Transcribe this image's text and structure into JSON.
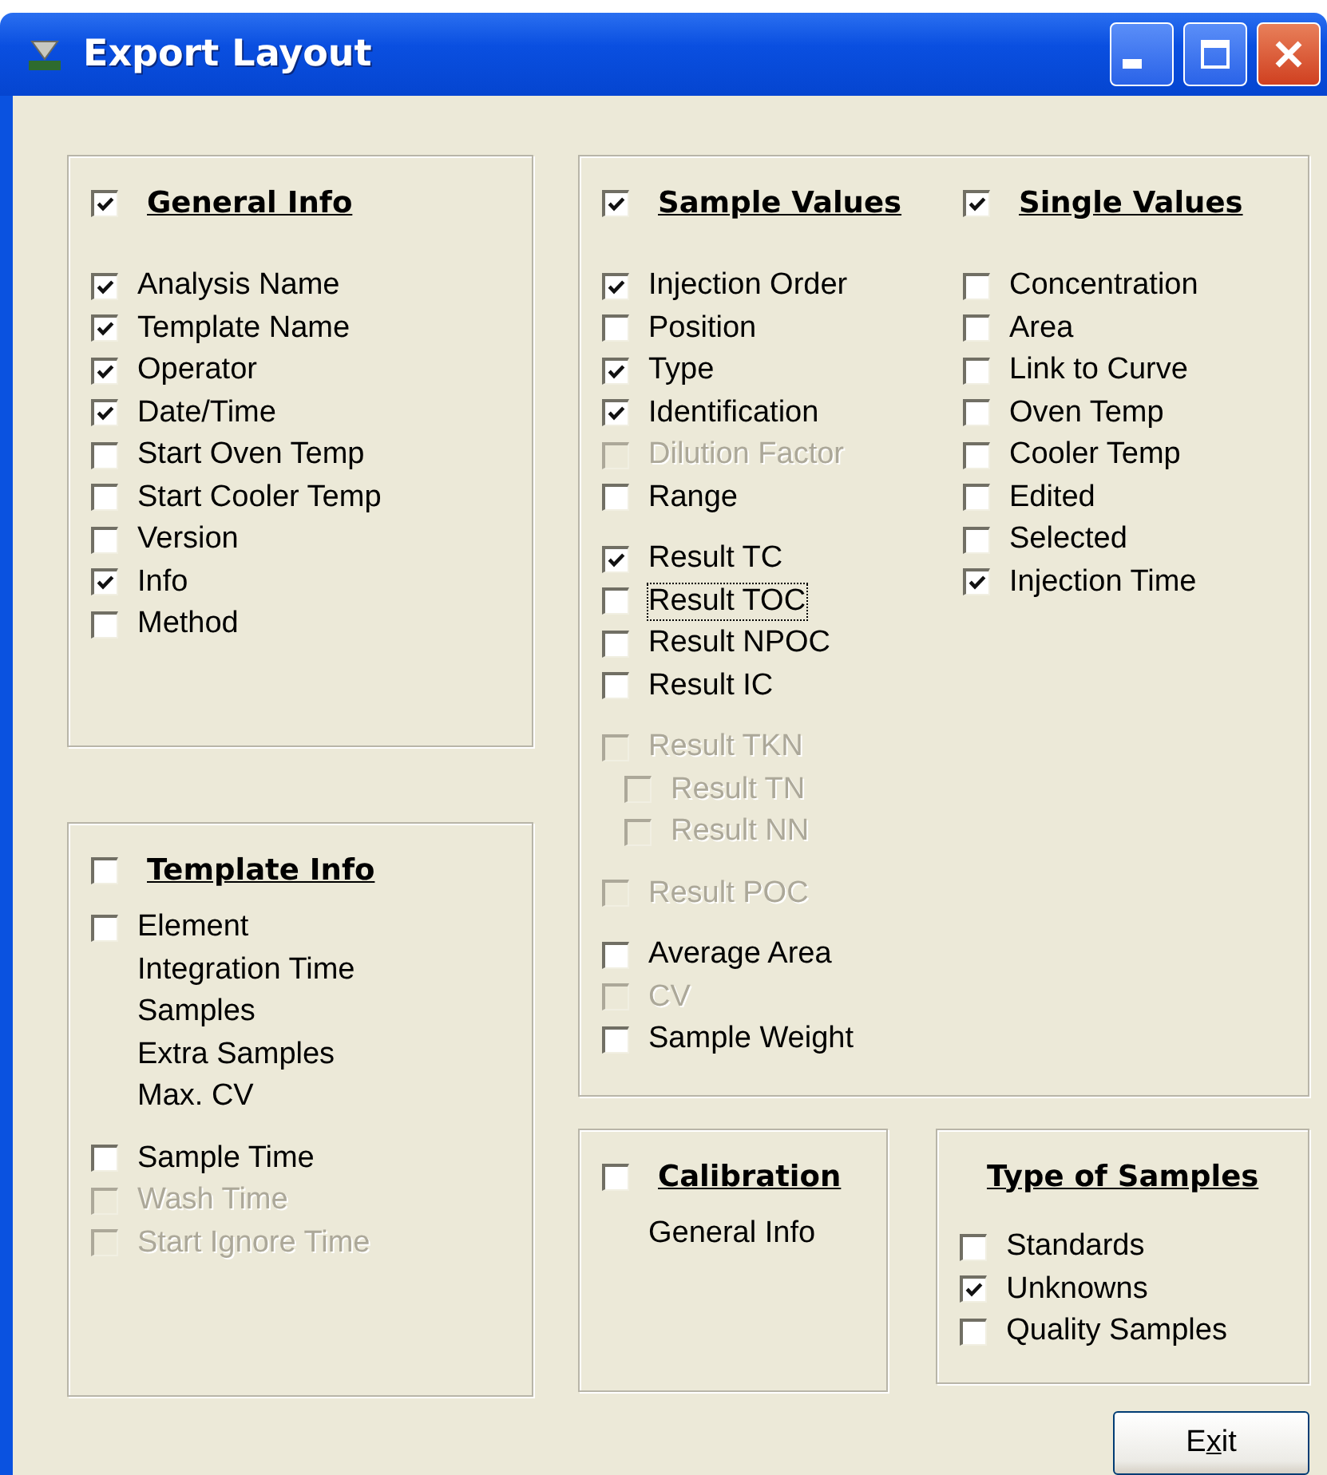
{
  "window": {
    "title": "Export Layout"
  },
  "general_info": {
    "title": "General Info",
    "checked": true,
    "groups": [
      [
        {
          "kind": "checkbox",
          "label": "Analysis Name",
          "checked": true,
          "disabled": false
        },
        {
          "kind": "checkbox",
          "label": "Template Name",
          "checked": true,
          "disabled": false
        },
        {
          "kind": "checkbox",
          "label": "Operator",
          "checked": true,
          "disabled": false
        },
        {
          "kind": "checkbox",
          "label": "Date/Time",
          "checked": true,
          "disabled": false
        },
        {
          "kind": "checkbox",
          "label": "Start Oven Temp",
          "checked": false,
          "disabled": false
        },
        {
          "kind": "checkbox",
          "label": "Start Cooler Temp",
          "checked": false,
          "disabled": false
        },
        {
          "kind": "checkbox",
          "label": "Version",
          "checked": false,
          "disabled": false
        },
        {
          "kind": "checkbox",
          "label": "Info",
          "checked": true,
          "disabled": false
        },
        {
          "kind": "checkbox",
          "label": "Method",
          "checked": false,
          "disabled": false
        }
      ]
    ]
  },
  "template_info": {
    "title": "Template Info",
    "checked": false,
    "groups": [
      [
        {
          "kind": "checkbox",
          "label": "Element",
          "checked": false,
          "disabled": false
        },
        {
          "kind": "text",
          "label": "Integration Time"
        },
        {
          "kind": "text",
          "label": "Samples"
        },
        {
          "kind": "text",
          "label": "Extra Samples"
        },
        {
          "kind": "text",
          "label": "Max. CV"
        }
      ],
      [
        {
          "kind": "checkbox",
          "label": "Sample Time",
          "checked": false,
          "disabled": false
        },
        {
          "kind": "checkbox",
          "label": "Wash Time",
          "checked": false,
          "disabled": true
        },
        {
          "kind": "checkbox",
          "label": "Start Ignore Time",
          "checked": false,
          "disabled": true
        }
      ]
    ]
  },
  "sample_values": {
    "title": "Sample Values",
    "checked": true,
    "groups": [
      [
        {
          "kind": "checkbox",
          "label": "Injection Order",
          "checked": true,
          "disabled": false
        },
        {
          "kind": "checkbox",
          "label": "Position",
          "checked": false,
          "disabled": false
        },
        {
          "kind": "checkbox",
          "label": "Type",
          "checked": true,
          "disabled": false
        },
        {
          "kind": "checkbox",
          "label": "Identification",
          "checked": true,
          "disabled": false
        },
        {
          "kind": "checkbox",
          "label": "Dilution Factor",
          "checked": false,
          "disabled": true
        },
        {
          "kind": "checkbox",
          "label": "Range",
          "checked": false,
          "disabled": false
        }
      ],
      [
        {
          "kind": "checkbox",
          "label": "Result TC",
          "checked": true,
          "disabled": false
        },
        {
          "kind": "checkbox",
          "label": "Result TOC",
          "checked": false,
          "disabled": false,
          "focused": true
        },
        {
          "kind": "checkbox",
          "label": "Result NPOC",
          "checked": false,
          "disabled": false
        },
        {
          "kind": "checkbox",
          "label": "Result IC",
          "checked": false,
          "disabled": false
        }
      ],
      [
        {
          "kind": "checkbox",
          "label": "Result TKN",
          "checked": false,
          "disabled": true,
          "children": [
            {
              "kind": "checkbox",
              "label": "Result TN",
              "checked": false,
              "disabled": true
            },
            {
              "kind": "checkbox",
              "label": "Result NN",
              "checked": false,
              "disabled": true
            }
          ]
        }
      ],
      [
        {
          "kind": "checkbox",
          "label": "Result POC",
          "checked": false,
          "disabled": true
        }
      ],
      [
        {
          "kind": "checkbox",
          "label": "Average Area",
          "checked": false,
          "disabled": false
        },
        {
          "kind": "checkbox",
          "label": "CV",
          "checked": false,
          "disabled": true
        },
        {
          "kind": "checkbox",
          "label": "Sample Weight",
          "checked": false,
          "disabled": false
        }
      ]
    ]
  },
  "single_values": {
    "title": "Single Values",
    "checked": true,
    "groups": [
      [
        {
          "kind": "checkbox",
          "label": "Concentration",
          "checked": false,
          "disabled": false
        },
        {
          "kind": "checkbox",
          "label": "Area",
          "checked": false,
          "disabled": false
        },
        {
          "kind": "checkbox",
          "label": "Link to Curve",
          "checked": false,
          "disabled": false
        },
        {
          "kind": "checkbox",
          "label": "Oven Temp",
          "checked": false,
          "disabled": false
        },
        {
          "kind": "checkbox",
          "label": "Cooler Temp",
          "checked": false,
          "disabled": false
        },
        {
          "kind": "checkbox",
          "label": "Edited",
          "checked": false,
          "disabled": false
        },
        {
          "kind": "checkbox",
          "label": "Selected",
          "checked": false,
          "disabled": false
        },
        {
          "kind": "checkbox",
          "label": "Injection Time",
          "checked": true,
          "disabled": false
        }
      ]
    ]
  },
  "calibration": {
    "title": "Calibration",
    "checked": false,
    "groups": [
      [
        {
          "kind": "text",
          "label": "General Info"
        }
      ]
    ]
  },
  "type_of_samples": {
    "title": "Type of Samples",
    "groups": [
      [
        {
          "kind": "checkbox",
          "label": "Standards",
          "checked": false,
          "disabled": false
        },
        {
          "kind": "checkbox",
          "label": "Unknowns",
          "checked": true,
          "disabled": false
        },
        {
          "kind": "checkbox",
          "label": "Quality Samples",
          "checked": false,
          "disabled": false
        }
      ]
    ]
  },
  "exit_button": {
    "label_before": "E",
    "access_key": "x",
    "label_after": "it"
  }
}
